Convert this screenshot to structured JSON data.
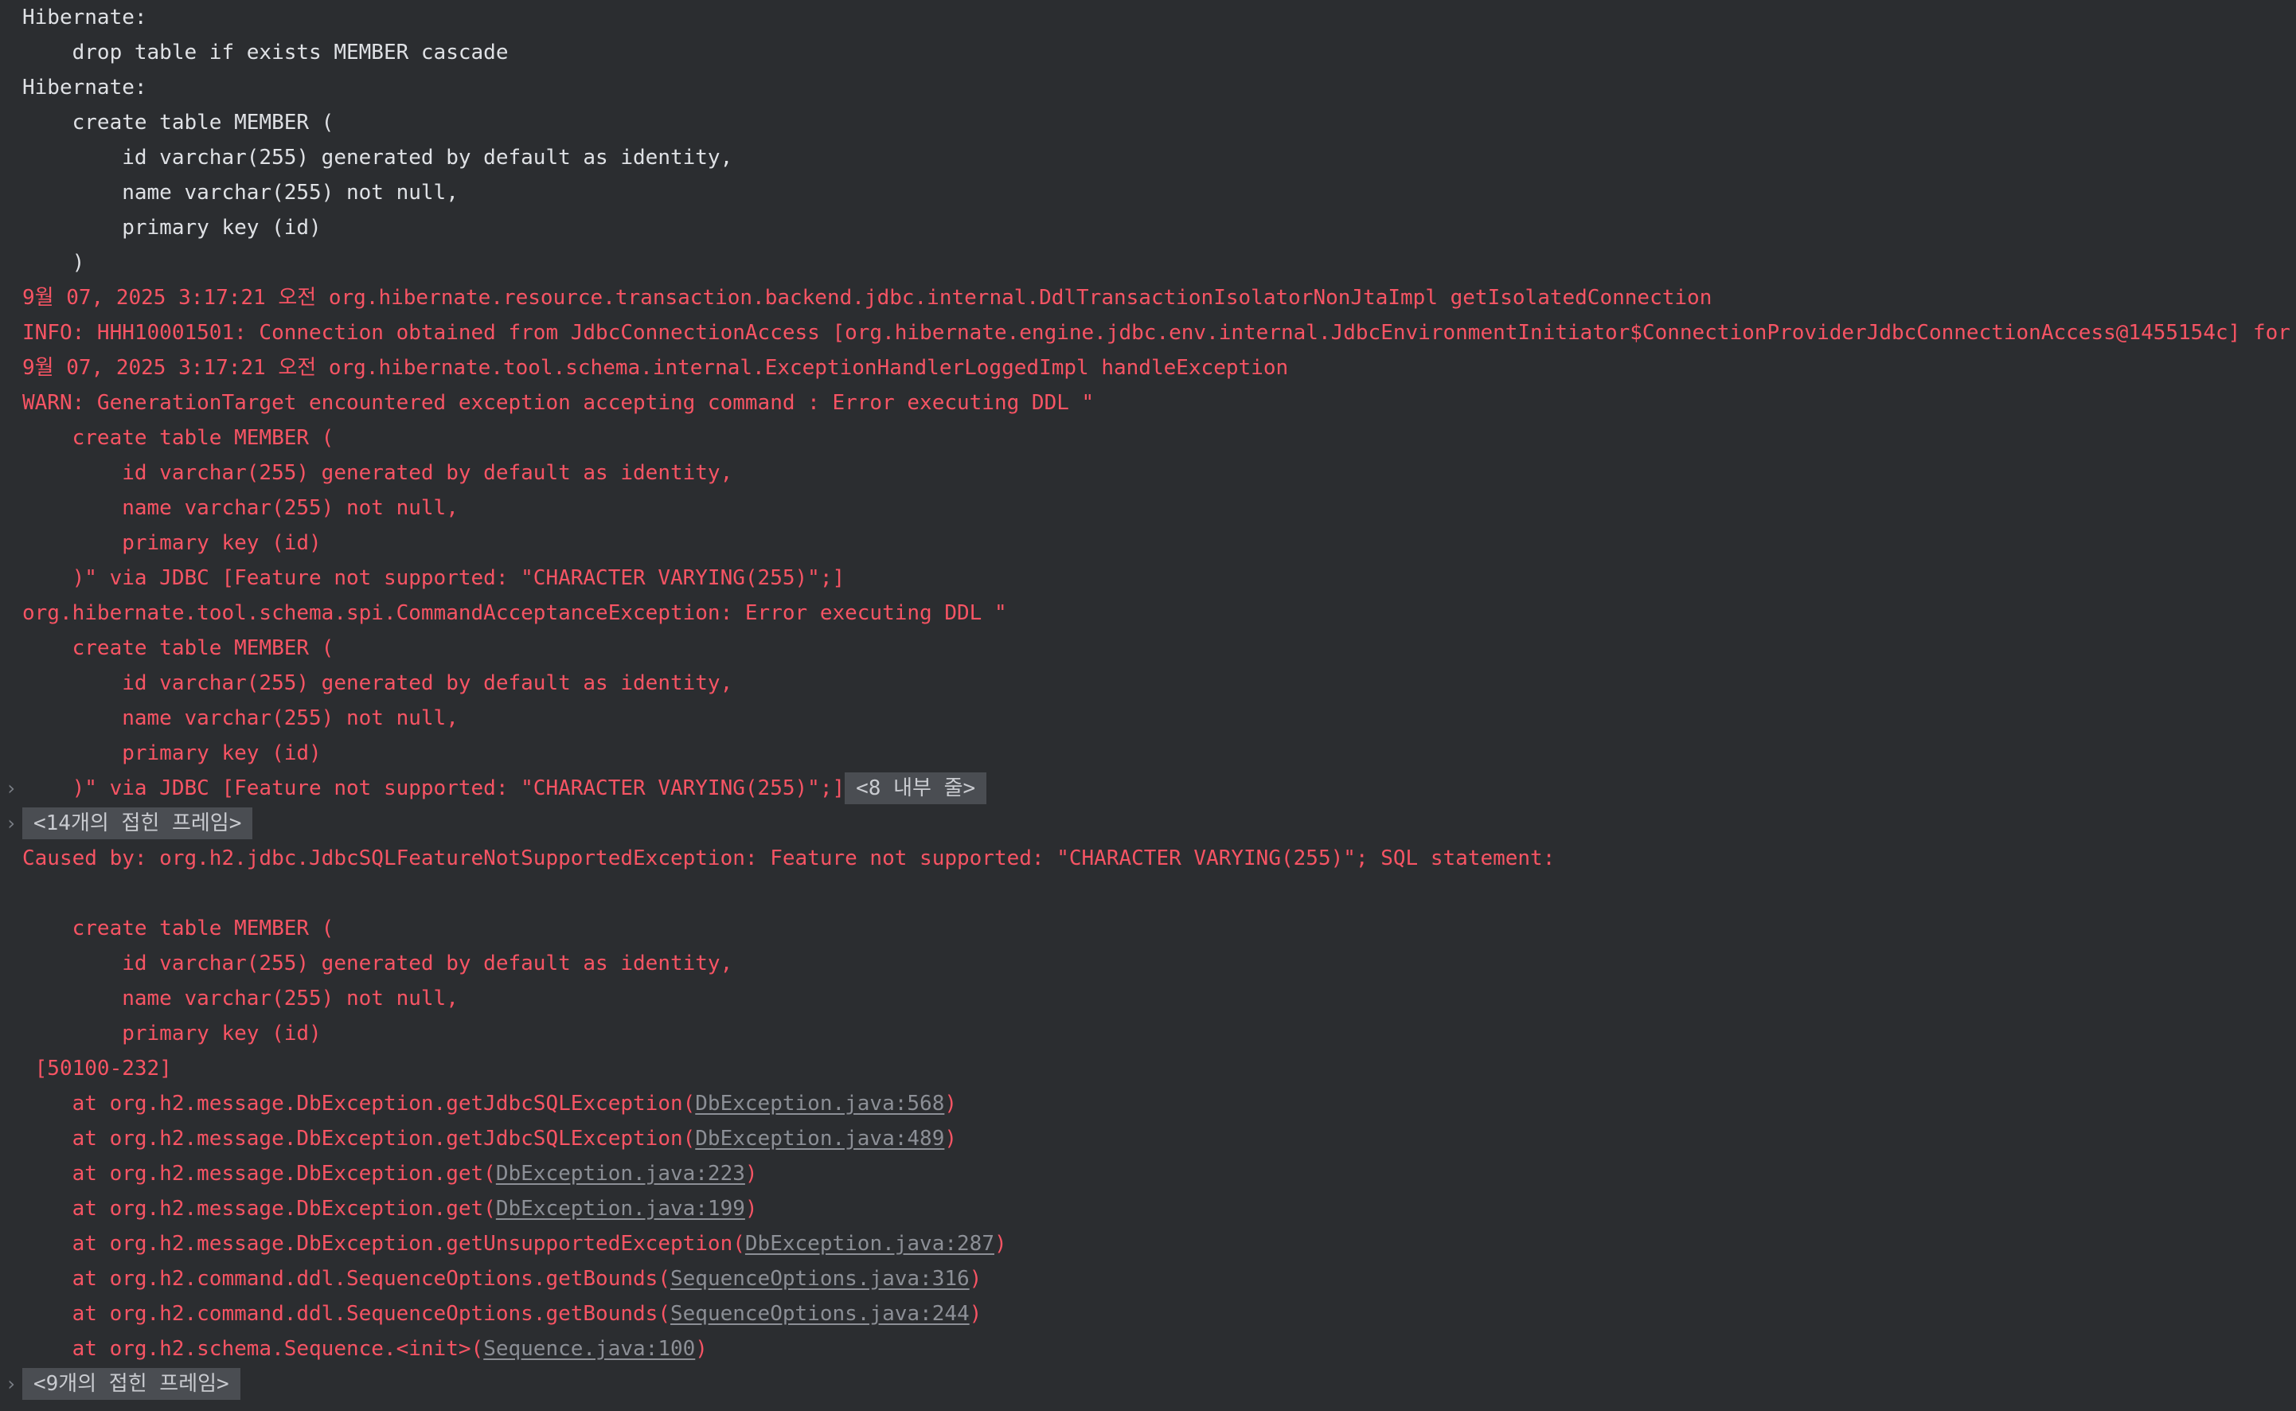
{
  "console": {
    "lines": [
      {
        "kind": "text",
        "color": "default",
        "text": "Hibernate: "
      },
      {
        "kind": "text",
        "color": "default",
        "text": "    drop table if exists MEMBER cascade "
      },
      {
        "kind": "text",
        "color": "default",
        "text": "Hibernate: "
      },
      {
        "kind": "text",
        "color": "default",
        "text": "    create table MEMBER ("
      },
      {
        "kind": "text",
        "color": "default",
        "text": "        id varchar(255) generated by default as identity,"
      },
      {
        "kind": "text",
        "color": "default",
        "text": "        name varchar(255) not null,"
      },
      {
        "kind": "text",
        "color": "default",
        "text": "        primary key (id)"
      },
      {
        "kind": "text",
        "color": "default",
        "text": "    )"
      },
      {
        "kind": "text",
        "color": "error",
        "text": "9월 07, 2025 3:17:21 오전 org.hibernate.resource.transaction.backend.jdbc.internal.DdlTransactionIsolatorNonJtaImpl getIsolatedConnection"
      },
      {
        "kind": "text",
        "color": "error",
        "text": "INFO: HHH10001501: Connection obtained from JdbcConnectionAccess [org.hibernate.engine.jdbc.env.internal.JdbcEnvironmentInitiator$ConnectionProviderJdbcConnectionAccess@1455154c] for"
      },
      {
        "kind": "text",
        "color": "error",
        "text": "9월 07, 2025 3:17:21 오전 org.hibernate.tool.schema.internal.ExceptionHandlerLoggedImpl handleException"
      },
      {
        "kind": "text",
        "color": "error",
        "text": "WARN: GenerationTarget encountered exception accepting command : Error executing DDL \""
      },
      {
        "kind": "text",
        "color": "error",
        "text": "    create table MEMBER ("
      },
      {
        "kind": "text",
        "color": "error",
        "text": "        id varchar(255) generated by default as identity,"
      },
      {
        "kind": "text",
        "color": "error",
        "text": "        name varchar(255) not null,"
      },
      {
        "kind": "text",
        "color": "error",
        "text": "        primary key (id)"
      },
      {
        "kind": "text",
        "color": "error",
        "text": "    )\" via JDBC [Feature not supported: \"CHARACTER VARYING(255)\";]"
      },
      {
        "kind": "text",
        "color": "error",
        "text": "org.hibernate.tool.schema.spi.CommandAcceptanceException: Error executing DDL \""
      },
      {
        "kind": "text",
        "color": "error",
        "text": "    create table MEMBER ("
      },
      {
        "kind": "text",
        "color": "error",
        "text": "        id varchar(255) generated by default as identity,"
      },
      {
        "kind": "text",
        "color": "error",
        "text": "        name varchar(255) not null,"
      },
      {
        "kind": "text",
        "color": "error",
        "text": "        primary key (id)"
      },
      {
        "kind": "fold-inline",
        "color": "error",
        "text": "    )\" via JDBC [Feature not supported: \"CHARACTER VARYING(255)\";]",
        "chip": "<8 내부 줄>"
      },
      {
        "kind": "fold",
        "chip": "<14개의 접힌 프레임>"
      },
      {
        "kind": "text",
        "color": "error",
        "text": "Caused by: org.h2.jdbc.JdbcSQLFeatureNotSupportedException: Feature not supported: \"CHARACTER VARYING(255)\"; SQL statement:"
      },
      {
        "kind": "text",
        "color": "error",
        "text": ""
      },
      {
        "kind": "text",
        "color": "error",
        "text": "    create table MEMBER ("
      },
      {
        "kind": "text",
        "color": "error",
        "text": "        id varchar(255) generated by default as identity,"
      },
      {
        "kind": "text",
        "color": "error",
        "text": "        name varchar(255) not null,"
      },
      {
        "kind": "text",
        "color": "error",
        "text": "        primary key (id)"
      },
      {
        "kind": "text",
        "color": "error",
        "text": " [50100-232]"
      },
      {
        "kind": "frame",
        "color": "error",
        "prefix": "    at org.h2.message.DbException.getJdbcSQLException(",
        "link": "DbException.java:568",
        "suffix": ")"
      },
      {
        "kind": "frame",
        "color": "error",
        "prefix": "    at org.h2.message.DbException.getJdbcSQLException(",
        "link": "DbException.java:489",
        "suffix": ")"
      },
      {
        "kind": "frame",
        "color": "error",
        "prefix": "    at org.h2.message.DbException.get(",
        "link": "DbException.java:223",
        "suffix": ")"
      },
      {
        "kind": "frame",
        "color": "error",
        "prefix": "    at org.h2.message.DbException.get(",
        "link": "DbException.java:199",
        "suffix": ")"
      },
      {
        "kind": "frame",
        "color": "error",
        "prefix": "    at org.h2.message.DbException.getUnsupportedException(",
        "link": "DbException.java:287",
        "suffix": ")"
      },
      {
        "kind": "frame",
        "color": "error",
        "prefix": "    at org.h2.command.ddl.SequenceOptions.getBounds(",
        "link": "SequenceOptions.java:316",
        "suffix": ")"
      },
      {
        "kind": "frame",
        "color": "error",
        "prefix": "    at org.h2.command.ddl.SequenceOptions.getBounds(",
        "link": "SequenceOptions.java:244",
        "suffix": ")"
      },
      {
        "kind": "frame",
        "color": "error",
        "prefix": "    at org.h2.schema.Sequence.<init>(",
        "link": "Sequence.java:100",
        "suffix": ")"
      },
      {
        "kind": "fold",
        "chip": "<9개의 접힌 프레임>"
      }
    ]
  },
  "icons": {
    "fold_arrow": "chevron-right-icon"
  },
  "colors": {
    "background": "#2b2d30",
    "default_text": "#dfe1e5",
    "error_text": "#f75464",
    "fold_chip_bg": "#4a4d52",
    "link_text": "#8c8f96"
  }
}
